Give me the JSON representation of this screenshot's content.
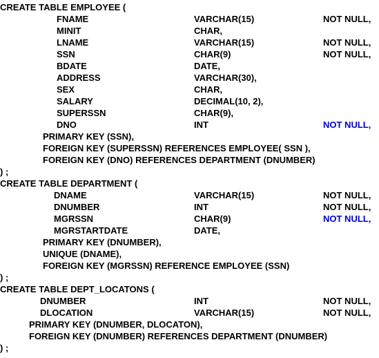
{
  "employee": {
    "create": "CREATE TABLE EMPLOYEE (",
    "rows": [
      {
        "name": "FNAME",
        "type": "VARCHAR(15)",
        "constraint": "NOT NULL,"
      },
      {
        "name": "MINIT",
        "type": "CHAR,",
        "constraint": ""
      },
      {
        "name": "LNAME",
        "type": "VARCHAR(15)",
        "constraint": "NOT NULL,"
      },
      {
        "name": "SSN",
        "type": "CHAR(9)",
        "constraint": "NOT NULL,"
      },
      {
        "name": "BDATE",
        "type": "DATE,",
        "constraint": ""
      },
      {
        "name": "ADDRESS",
        "type": "VARCHAR(30),",
        "constraint": ""
      },
      {
        "name": "SEX",
        "type": "CHAR,",
        "constraint": ""
      },
      {
        "name": "SALARY",
        "type": "DECIMAL(10, 2),",
        "constraint": ""
      },
      {
        "name": "SUPERSSN",
        "type": "CHAR(9),",
        "constraint": ""
      },
      {
        "name": "DNO",
        "type": "INT",
        "constraint": "NOT NULL,"
      }
    ],
    "keys": [
      "PRIMARY KEY (SSN),",
      "FOREIGN KEY (SUPERSSN) REFERENCES EMPLOYEE( SSN ),",
      "FOREIGN KEY (DNO) REFERENCES DEPARTMENT (DNUMBER)"
    ],
    "close": ") ;"
  },
  "department": {
    "create": "CREATE TABLE DEPARTMENT (",
    "rows": [
      {
        "name": "DNAME",
        "type": "VARCHAR(15)",
        "constraint": "NOT NULL,"
      },
      {
        "name": "DNUMBER",
        "type": "INT",
        "constraint": "NOT NULL,"
      },
      {
        "name": "MGRSSN",
        "type": "CHAR(9)",
        "constraint": "NOT NULL,"
      },
      {
        "name": "MGRSTARTDATE",
        "type": "DATE,",
        "constraint": ""
      }
    ],
    "keys": [
      "PRIMARY KEY (DNUMBER),",
      "UNIQUE (DNAME),",
      "FOREIGN KEY (MGRSSN) REFERENCE EMPLOYEE (SSN)"
    ],
    "close": ") ;"
  },
  "dept_locations": {
    "create": "CREATE TABLE DEPT_LOCATONS (",
    "rows": [
      {
        "name": "DNUMBER",
        "type": "INT",
        "constraint": "NOT NULL,"
      },
      {
        "name": "DLOCATION",
        "type": "VARCHAR(15)",
        "constraint": "NOT NULL,"
      }
    ],
    "keys": [
      "PRIMARY KEY (DNUMBER, DLOCATON),",
      "FOREIGN KEY (DNUMBER) REFERENCES DEPARTMENT (DNUMBER)"
    ],
    "close": ") ;"
  },
  "colors": {
    "text": "#000000",
    "highlight": "#0000cc",
    "background": "#ffffff"
  }
}
